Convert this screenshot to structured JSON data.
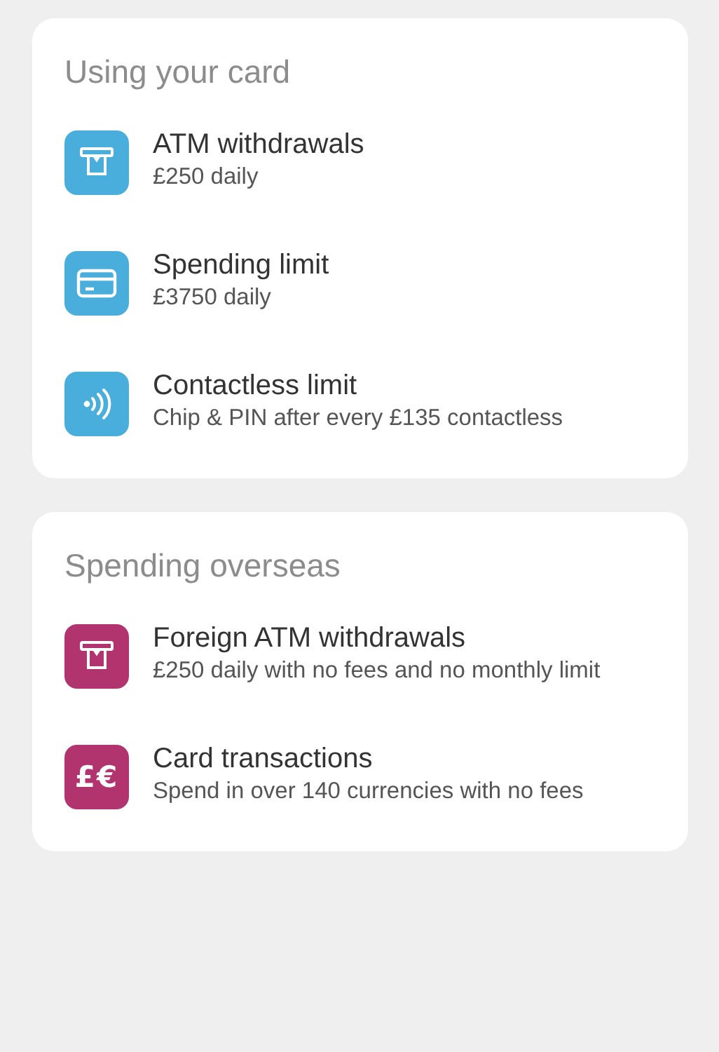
{
  "sections": [
    {
      "title": "Using your card",
      "items": [
        {
          "kind": "atm",
          "color": "#4aaedc",
          "title": "ATM withdrawals",
          "detail": "£250 daily"
        },
        {
          "kind": "card",
          "color": "#4aaedc",
          "title": "Spending limit",
          "detail": "£3750 daily"
        },
        {
          "kind": "contactless",
          "color": "#4aaedc",
          "title": "Contactless limit",
          "detail": "Chip & PIN after every £135 contactless"
        }
      ]
    },
    {
      "title": "Spending overseas",
      "items": [
        {
          "kind": "atm",
          "color": "#b2346f",
          "title": "Foreign ATM withdrawals",
          "detail": "£250 daily with no fees and no monthly limit"
        },
        {
          "kind": "currency",
          "color": "#b2346f",
          "icon_text": "£€",
          "title": "Card transactions",
          "detail": "Spend in over 140 currencies with no fees"
        }
      ]
    }
  ]
}
